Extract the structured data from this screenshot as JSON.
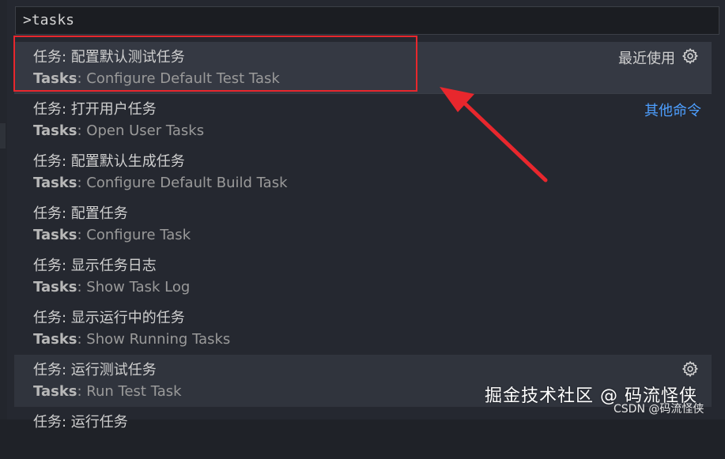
{
  "input": {
    "value": ">tasks"
  },
  "items": [
    {
      "title": "任务: 配置默认测试任务",
      "prefix": "Tasks",
      "desc": ": Configure Default Test Task",
      "right_label": "最近使用"
    },
    {
      "title": "任务: 打开用户任务",
      "prefix": "Tasks",
      "desc": ": Open User Tasks",
      "right_link": "其他命令"
    },
    {
      "title": "任务: 配置默认生成任务",
      "prefix": "Tasks",
      "desc": ": Configure Default Build Task"
    },
    {
      "title": "任务: 配置任务",
      "prefix": "Tasks",
      "desc": ": Configure Task"
    },
    {
      "title": "任务: 显示任务日志",
      "prefix": "Tasks",
      "desc": ": Show Task Log"
    },
    {
      "title": "任务: 显示运行中的任务",
      "prefix": "Tasks",
      "desc": ": Show Running Tasks"
    },
    {
      "title": "任务: 运行测试任务",
      "prefix": "Tasks",
      "desc": ": Run Test Task"
    },
    {
      "title": "任务: 运行任务"
    }
  ],
  "watermark": {
    "main": "掘金技术社区 @ 码流怪侠",
    "sub": "CSDN @码流怪侠"
  },
  "colors": {
    "annotation": "#e8272d",
    "link": "#4d9fff"
  }
}
